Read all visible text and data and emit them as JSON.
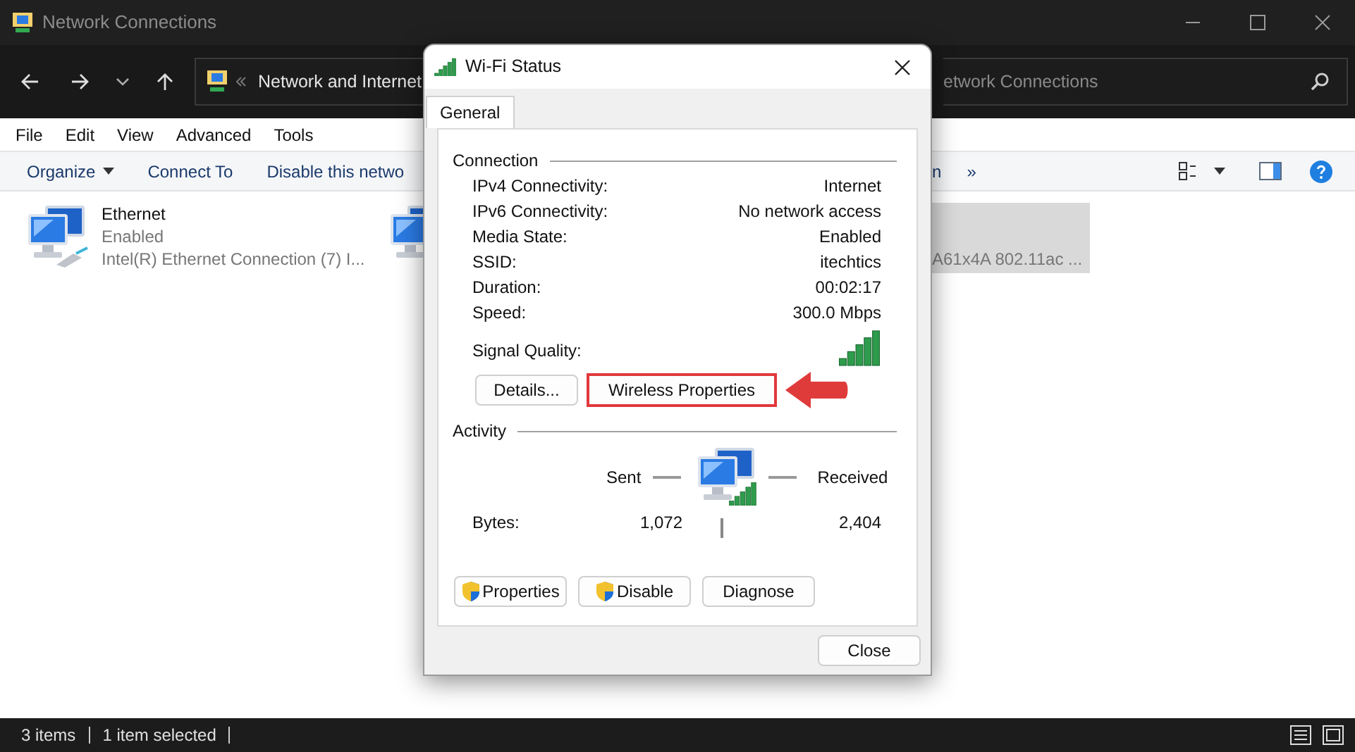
{
  "explorer": {
    "title": "Network Connections",
    "breadcrumb": "Network and Internet",
    "search": "etwork Connections",
    "menu": [
      "File",
      "Edit",
      "View",
      "Advanced",
      "Tools"
    ],
    "toolbar": [
      {
        "label": "Organize",
        "dropdown": true
      },
      {
        "label": "Connect To",
        "dropdown": false
      },
      {
        "label": "Disable this netwo",
        "dropdown": false
      }
    ],
    "toolbar_more": [
      "n",
      "»"
    ],
    "items": [
      {
        "kind": "full",
        "name": "Ethernet",
        "status": "Enabled",
        "device": "Intel(R) Ethernet Connection (7) I...",
        "selected": false
      },
      {
        "kind": "icon_only",
        "selected": false
      },
      {
        "kind": "text_only",
        "device": "A61x4A 802.11ac ...",
        "selected": true
      }
    ],
    "status_bar": [
      "3 items",
      "1 item selected"
    ]
  },
  "dialog": {
    "title": "Wi-Fi Status",
    "tabs": [
      {
        "label": "General",
        "selected": true
      }
    ],
    "connection": {
      "title": "Connection",
      "rows": [
        {
          "label": "IPv4 Connectivity:",
          "value": "Internet"
        },
        {
          "label": "IPv6 Connectivity:",
          "value": "No network access"
        },
        {
          "label": "Media State:",
          "value": "Enabled"
        },
        {
          "label": "SSID:",
          "value": "itechtics"
        },
        {
          "label": "Duration:",
          "value": "00:02:17"
        },
        {
          "label": "Speed:",
          "value": "300.0 Mbps"
        }
      ],
      "signal_label": "Signal Quality:",
      "buttons": [
        {
          "label": "Details...",
          "highlighted": false
        },
        {
          "label": "Wireless Properties",
          "highlighted": true
        }
      ]
    },
    "activity": {
      "title": "Activity",
      "sent": "Sent",
      "received": "Received",
      "bytes_label": "Bytes:",
      "sent_bytes": "1,072",
      "received_bytes": "2,404"
    },
    "action_buttons": [
      {
        "label": "Properties",
        "shield": true
      },
      {
        "label": "Disable",
        "shield": true
      },
      {
        "label": "Diagnose",
        "shield": false
      }
    ],
    "close": "Close"
  }
}
